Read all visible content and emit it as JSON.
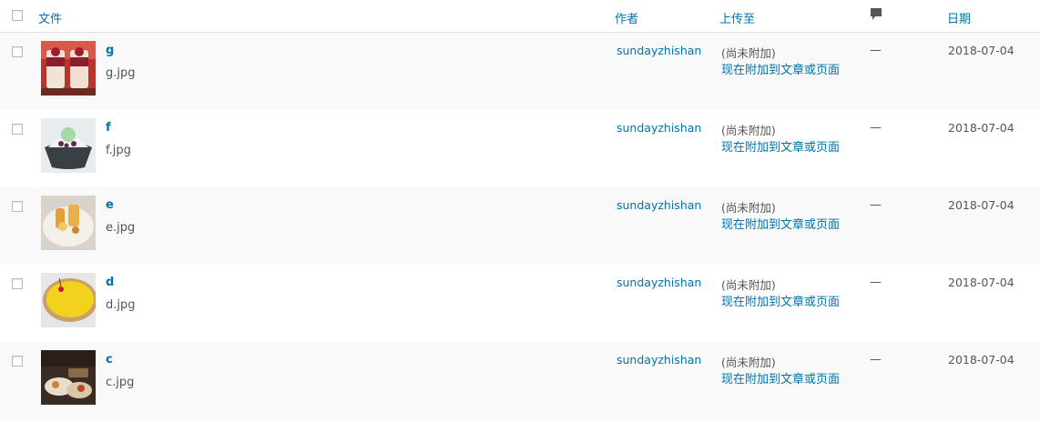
{
  "header": {
    "file": "文件",
    "author": "作者",
    "uploaded_to": "上传至",
    "comments_icon": "comment-bubble-icon",
    "date": "日期"
  },
  "rows": [
    {
      "title": "g",
      "filename": "g.jpg",
      "author": "sundayzhishan",
      "status": "(尚未附加)",
      "attach_link": "现在附加到文章或页面",
      "comments": "—",
      "date": "2018-07-04"
    },
    {
      "title": "f",
      "filename": "f.jpg",
      "author": "sundayzhishan",
      "status": "(尚未附加)",
      "attach_link": "现在附加到文章或页面",
      "comments": "—",
      "date": "2018-07-04"
    },
    {
      "title": "e",
      "filename": "e.jpg",
      "author": "sundayzhishan",
      "status": "(尚未附加)",
      "attach_link": "现在附加到文章或页面",
      "comments": "—",
      "date": "2018-07-04"
    },
    {
      "title": "d",
      "filename": "d.jpg",
      "author": "sundayzhishan",
      "status": "(尚未附加)",
      "attach_link": "现在附加到文章或页面",
      "comments": "—",
      "date": "2018-07-04"
    },
    {
      "title": "c",
      "filename": "c.jpg",
      "author": "sundayzhishan",
      "status": "(尚未附加)",
      "attach_link": "现在附加到文章或页面",
      "comments": "—",
      "date": "2018-07-04"
    }
  ],
  "colors": {
    "link": "#0073aa",
    "alt_row": "#f9f9f9",
    "text": "#555555"
  }
}
